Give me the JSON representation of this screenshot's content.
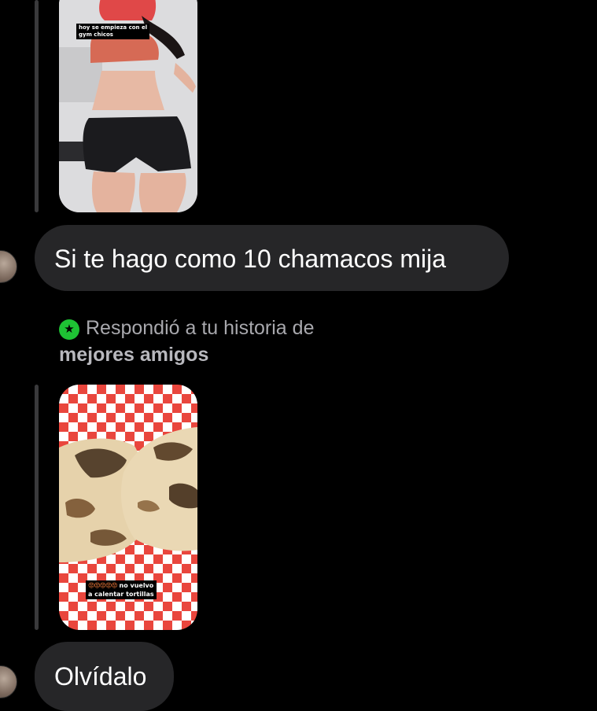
{
  "thread": {
    "story_1": {
      "caption_line_1": "hoy se empieza con el",
      "caption_line_2": "gym chicos"
    },
    "message_1": {
      "text": "Si te hago como 10 chamacos mija"
    },
    "story_reply_context": {
      "icon": "star-icon",
      "text": "Respondió a tu historia de",
      "highlight": "mejores amigos"
    },
    "story_2": {
      "caption_emojis": "😡😡😡😡😡",
      "caption_line_1": "no vuelvo",
      "caption_line_2": "a calentar tortillas"
    },
    "message_2": {
      "text": "Olvídalo"
    }
  },
  "colors": {
    "background": "#000000",
    "bubble": "#262628",
    "reply_bar": "#3a3a3c",
    "close_friends_green": "#1ec234",
    "secondary_text": "#a8a8ad"
  }
}
